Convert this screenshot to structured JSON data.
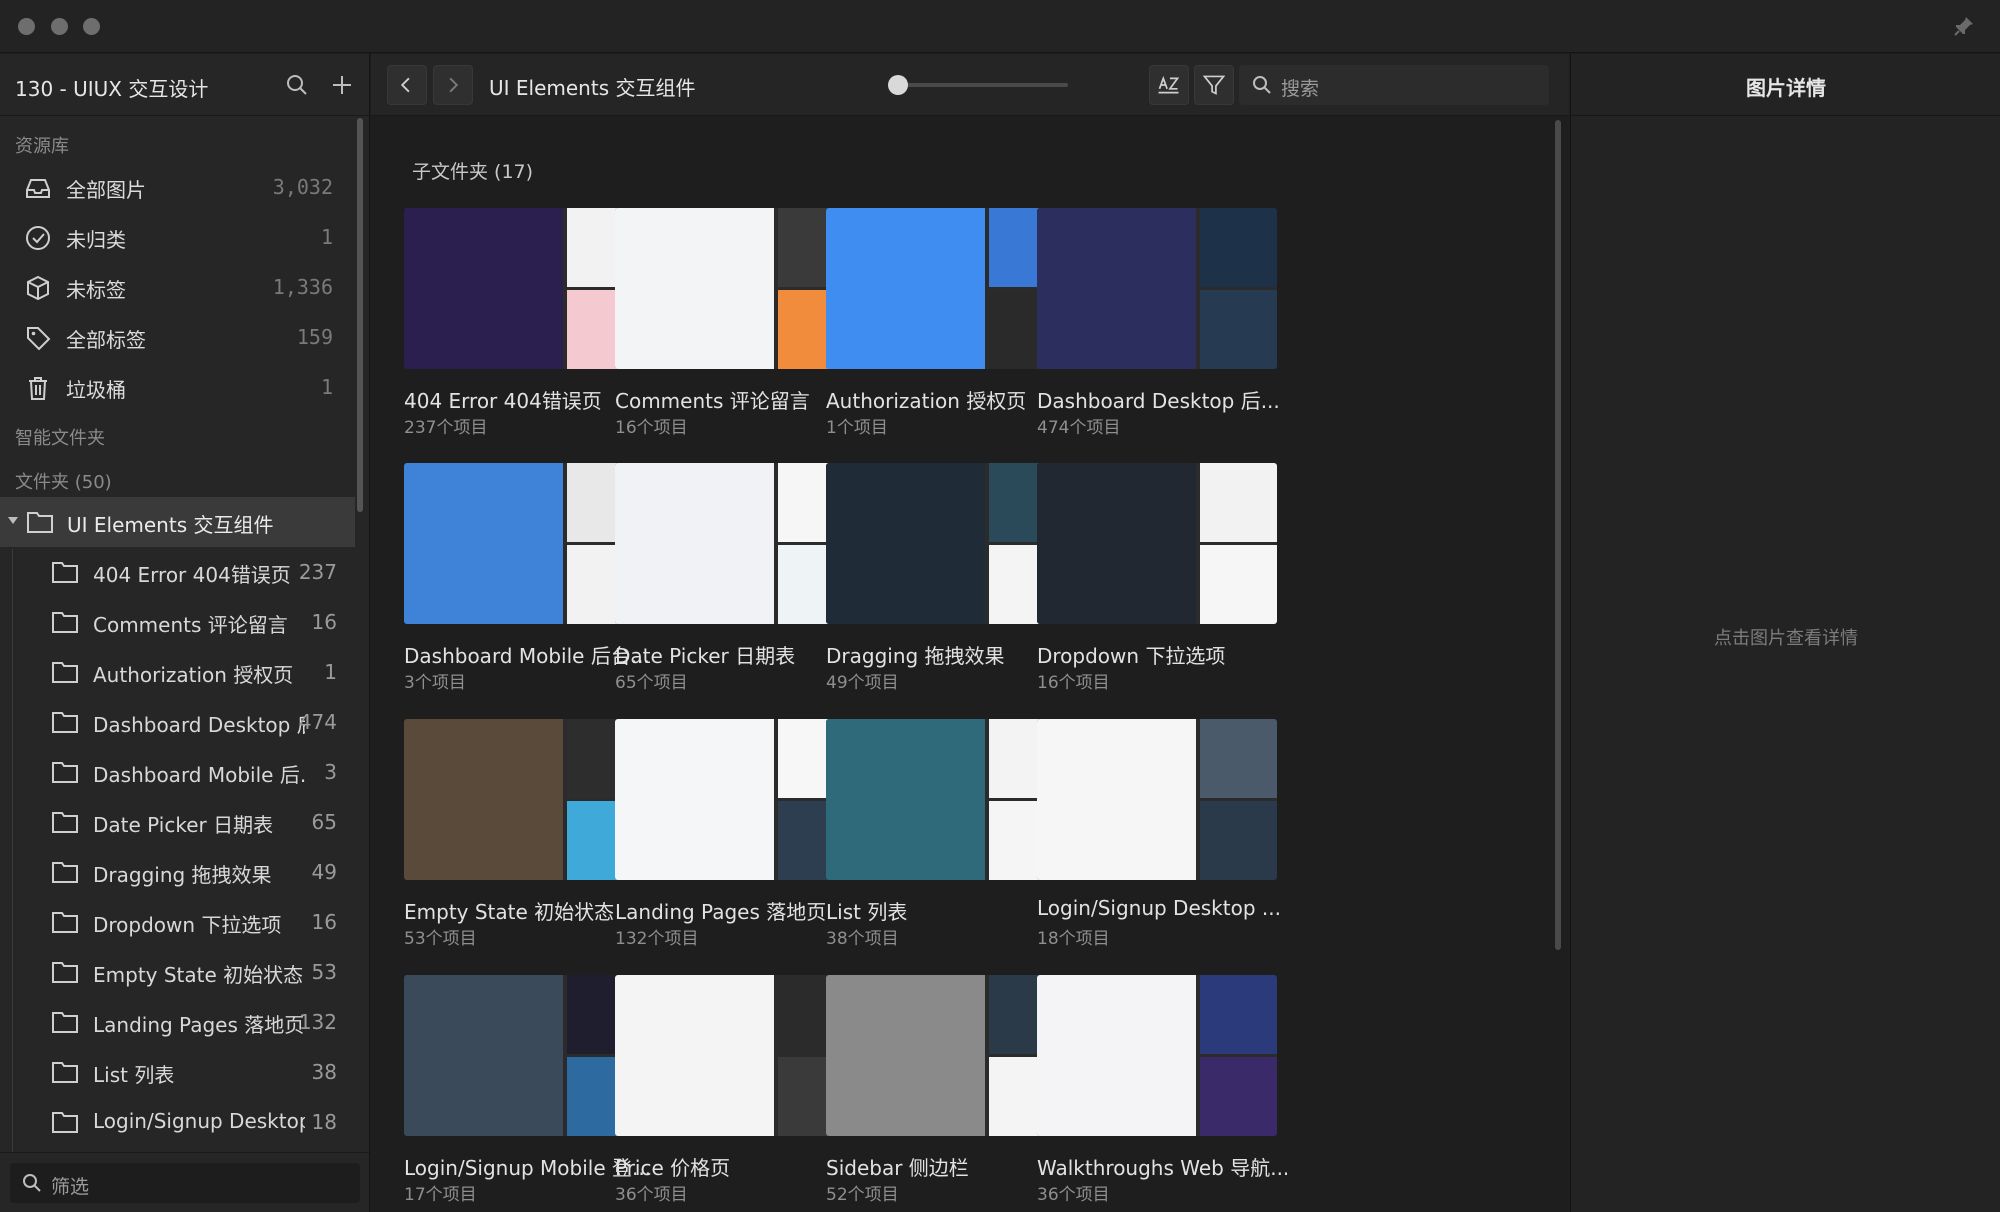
{
  "library": {
    "title": "130 - UIUX 交互设计",
    "resources_label": "资源库",
    "items": [
      {
        "label": "全部图片",
        "count": "3,032",
        "icon": "inbox-icon"
      },
      {
        "label": "未归类",
        "count": "1",
        "icon": "check-circle-icon"
      },
      {
        "label": "未标签",
        "count": "1,336",
        "icon": "box-icon"
      },
      {
        "label": "全部标签",
        "count": "159",
        "icon": "tag-icon"
      },
      {
        "label": "垃圾桶",
        "count": "1",
        "icon": "trash-icon"
      }
    ],
    "smart_folders_label": "智能文件夹",
    "folders_label": "文件夹 (50)",
    "root_folder": "UI Elements 交互组件",
    "subfolders": [
      {
        "label": "404 Error 404错误页",
        "count": "237"
      },
      {
        "label": "Comments 评论留言",
        "count": "16"
      },
      {
        "label": "Authorization 授权页",
        "count": "1"
      },
      {
        "label": "Dashboard Desktop 后..",
        "count": "474"
      },
      {
        "label": "Dashboard Mobile 后...",
        "count": "3"
      },
      {
        "label": "Date Picker 日期表",
        "count": "65"
      },
      {
        "label": "Dragging 拖拽效果",
        "count": "49"
      },
      {
        "label": "Dropdown 下拉选项",
        "count": "16"
      },
      {
        "label": "Empty State 初始状态",
        "count": "53"
      },
      {
        "label": "Landing Pages 落地页",
        "count": "132"
      },
      {
        "label": "List 列表",
        "count": "38"
      },
      {
        "label": "Login/Signup Desktop...",
        "count": "18"
      }
    ],
    "filter_placeholder": "筛选"
  },
  "toolbar": {
    "breadcrumb": "UI Elements 交互组件",
    "search_placeholder": "搜索",
    "zoom_level": 0.05
  },
  "grid": {
    "heading": "子文件夹 (17)",
    "cards": [
      {
        "name": "404 Error 404错误页",
        "count": "237个项目",
        "colors": [
          "#2a1f4e",
          "#f2f2f2",
          "#f4c9cf"
        ]
      },
      {
        "name": "Comments 评论留言",
        "count": "16个项目",
        "colors": [
          "#f3f4f6",
          "#3a3a3a",
          "#f08c3c"
        ]
      },
      {
        "name": "Authorization 授权页",
        "count": "1个项目",
        "colors": [
          "#3f8df0",
          "#3a78d6",
          "#2a2a2a"
        ]
      },
      {
        "name": "Dashboard Desktop 后...",
        "count": "474个项目",
        "colors": [
          "#2c2f5e",
          "#1d3148",
          "#263a52"
        ]
      },
      {
        "name": "Dashboard Mobile 后台...",
        "count": "3个项目",
        "colors": [
          "#3f83d9",
          "#e8e8e8",
          "#f2f2f2"
        ]
      },
      {
        "name": "Date Picker 日期表",
        "count": "65个项目",
        "colors": [
          "#f1f2f5",
          "#f6f6f6",
          "#eef4f6"
        ]
      },
      {
        "name": "Dragging 拖拽效果",
        "count": "49个项目",
        "colors": [
          "#1f2b36",
          "#2a4a5a",
          "#f4f4f4"
        ]
      },
      {
        "name": "Dropdown 下拉选项",
        "count": "16个项目",
        "colors": [
          "#222831",
          "#f2f2f2",
          "#f6f6f6"
        ]
      },
      {
        "name": "Empty State 初始状态",
        "count": "53个项目",
        "colors": [
          "#5a4a3a",
          "#2d2d2d",
          "#3fa9d9"
        ]
      },
      {
        "name": "Landing Pages 落地页",
        "count": "132个项目",
        "colors": [
          "#f5f6f8",
          "#f7f7f7",
          "#2c3e50"
        ]
      },
      {
        "name": "List 列表",
        "count": "38个项目",
        "colors": [
          "#2e6a7a",
          "#f3f3f3",
          "#f5f5f5"
        ]
      },
      {
        "name": "Login/Signup Desktop ...",
        "count": "18个项目",
        "colors": [
          "#f6f6f6",
          "#4a5a6a",
          "#2a3a4a"
        ]
      },
      {
        "name": "Login/Signup Mobile 登...",
        "count": "17个项目",
        "colors": [
          "#3a4a5a",
          "#1e1e2e",
          "#2c6aa0"
        ]
      },
      {
        "name": "Price 价格页",
        "count": "36个项目",
        "colors": [
          "#f4f4f4",
          "#2b2b2b",
          "#3a3a3a"
        ]
      },
      {
        "name": "Sidebar 侧边栏",
        "count": "52个项目",
        "colors": [
          "#8a8a8a",
          "#2a3a48",
          "#f4f4f4"
        ]
      },
      {
        "name": "Walkthroughs Web 导航...",
        "count": "36个项目",
        "colors": [
          "#f4f4f6",
          "#2a3a7a",
          "#3a2a6a"
        ]
      }
    ]
  },
  "details": {
    "title": "图片详情",
    "empty_hint": "点击图片查看详情"
  }
}
